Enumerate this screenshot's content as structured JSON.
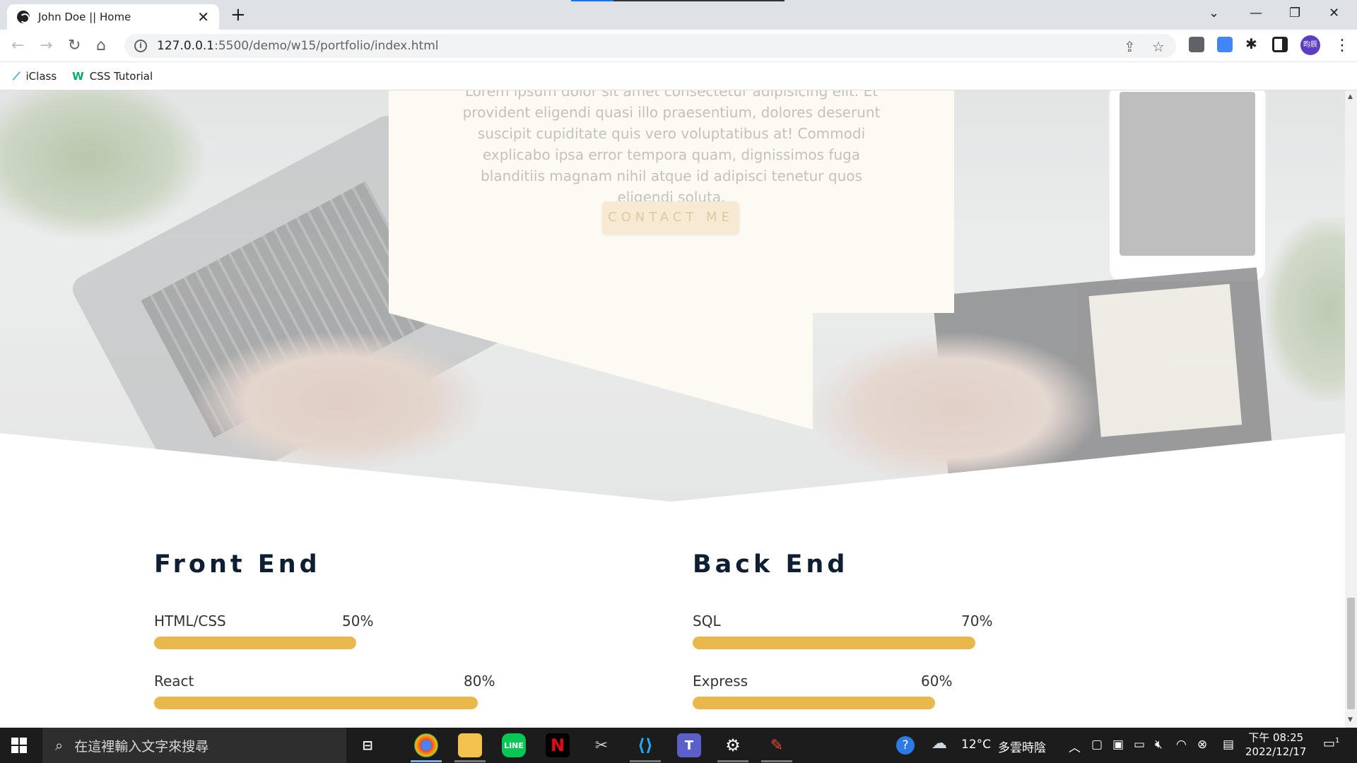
{
  "browser": {
    "tab_title": "John Doe || Home",
    "url_host": "127.0.0.1",
    "url_rest": ":5500/demo/w15/portfolio/index.html",
    "bookmarks": [
      {
        "label": "iClass",
        "icon": "iclass-icon"
      },
      {
        "label": "CSS Tutorial",
        "icon": "w3schools-icon"
      }
    ],
    "profile_initials": "昀辰"
  },
  "hero": {
    "paragraph": "Lorem ipsum dolor sit amet consectetur adipisicing elit. Et provident eligendi quasi illo praesentium, dolores deserunt suscipit cupiditate quis vero voluptatibus at! Commodi explicabo ipsa error tempora quam, dignissimos fuga blanditiis magnam nihil atque id adipisci tenetur quos eligendi soluta.",
    "contact_label": "CONTACT ME"
  },
  "skills": {
    "front": {
      "title": "Front End",
      "items": [
        {
          "label": "HTML/CSS",
          "percent_text": "50%",
          "percent": 50
        },
        {
          "label": "React",
          "percent_text": "80%",
          "percent": 80
        }
      ]
    },
    "back": {
      "title": "Back End",
      "items": [
        {
          "label": "SQL",
          "percent_text": "70%",
          "percent": 70
        },
        {
          "label": "Express",
          "percent_text": "60%",
          "percent": 60
        }
      ]
    }
  },
  "colors": {
    "accent": "#e9b84a",
    "heading": "#0f1f33",
    "card": "#fdfaf4"
  },
  "taskbar": {
    "search_placeholder": "在這裡輸入文字來搜尋",
    "weather_temp": "12°C",
    "weather_desc": "多雲時陰",
    "time_period": "下午 08:25",
    "date": "2022/12/17",
    "notification_count": "1"
  }
}
